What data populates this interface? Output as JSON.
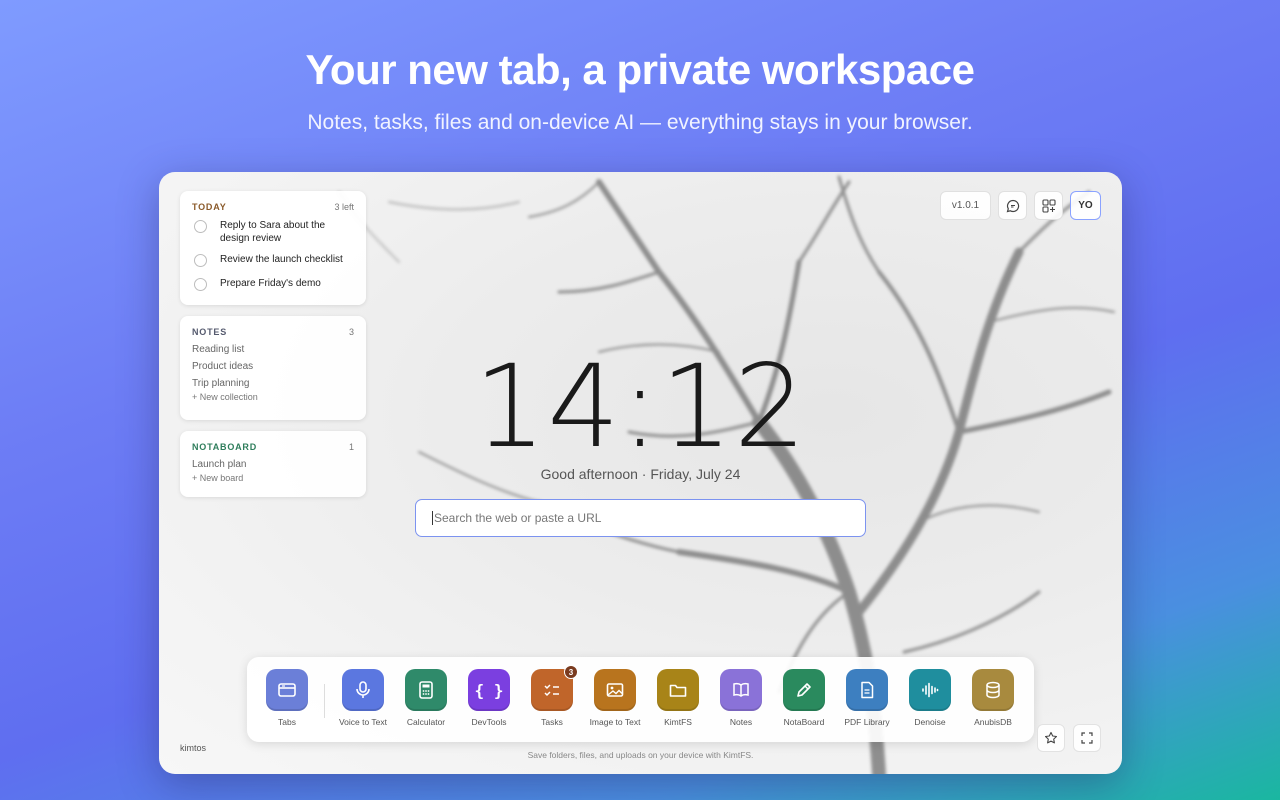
{
  "hero": {
    "title": "Your new tab, a private workspace",
    "subtitle": "Notes, tasks, files and on-device AI — everything stays in your browser."
  },
  "today": {
    "title": "TODAY",
    "count": "3 left",
    "tasks": [
      {
        "text": "Reply to Sara about the design review"
      },
      {
        "text": "Review the launch checklist"
      },
      {
        "text": "Prepare Friday's demo"
      }
    ]
  },
  "notes": {
    "title": "NOTES",
    "count": "3",
    "items": [
      "Reading list",
      "Product ideas",
      "Trip planning"
    ],
    "new_label": "+ New collection"
  },
  "notaboard": {
    "title": "NOTABOARD",
    "count": "1",
    "items": [
      "Launch plan"
    ],
    "new_label": "+ New board"
  },
  "topbar": {
    "version": "v1.0.1",
    "avatar": "YO"
  },
  "clock": {
    "time": "14:12",
    "greeting": "Good afternoon · Friday, July 24"
  },
  "search": {
    "placeholder": "Search the web or paste a URL"
  },
  "dock": {
    "apps": [
      {
        "label": "Tabs",
        "color": "#6b7fd8",
        "icon": "tabs-icon"
      },
      {
        "label": "Voice to Text",
        "color": "#5b77e0",
        "icon": "microphone-icon"
      },
      {
        "label": "Calculator",
        "color": "#2f8a6a",
        "icon": "calculator-icon"
      },
      {
        "label": "DevTools",
        "color": "#7b3fe0",
        "icon": "code-braces-icon"
      },
      {
        "label": "Tasks",
        "color": "#c0652a",
        "icon": "checklist-icon",
        "badge": "3"
      },
      {
        "label": "Image to Text",
        "color": "#b8741e",
        "icon": "image-icon"
      },
      {
        "label": "KimtFS",
        "color": "#a88418",
        "icon": "folder-icon"
      },
      {
        "label": "Notes",
        "color": "#8a72d8",
        "icon": "book-icon"
      },
      {
        "label": "NotaBoard",
        "color": "#2a8a5e",
        "icon": "pencil-icon"
      },
      {
        "label": "PDF Library",
        "color": "#3d7fc0",
        "icon": "document-icon"
      },
      {
        "label": "Denoise",
        "color": "#1f8e9e",
        "icon": "waveform-icon"
      },
      {
        "label": "AnubisDB",
        "color": "#a88a3e",
        "icon": "database-icon"
      }
    ]
  },
  "footer": {
    "brand": "kimtos",
    "hint": "Save folders, files, and uploads on your device with KimtFS."
  },
  "colors": {
    "accent": "#7c93f0",
    "today_title": "#8a5a2a",
    "notes_title": "#555a6e",
    "notaboard_title": "#2e7d5b"
  }
}
